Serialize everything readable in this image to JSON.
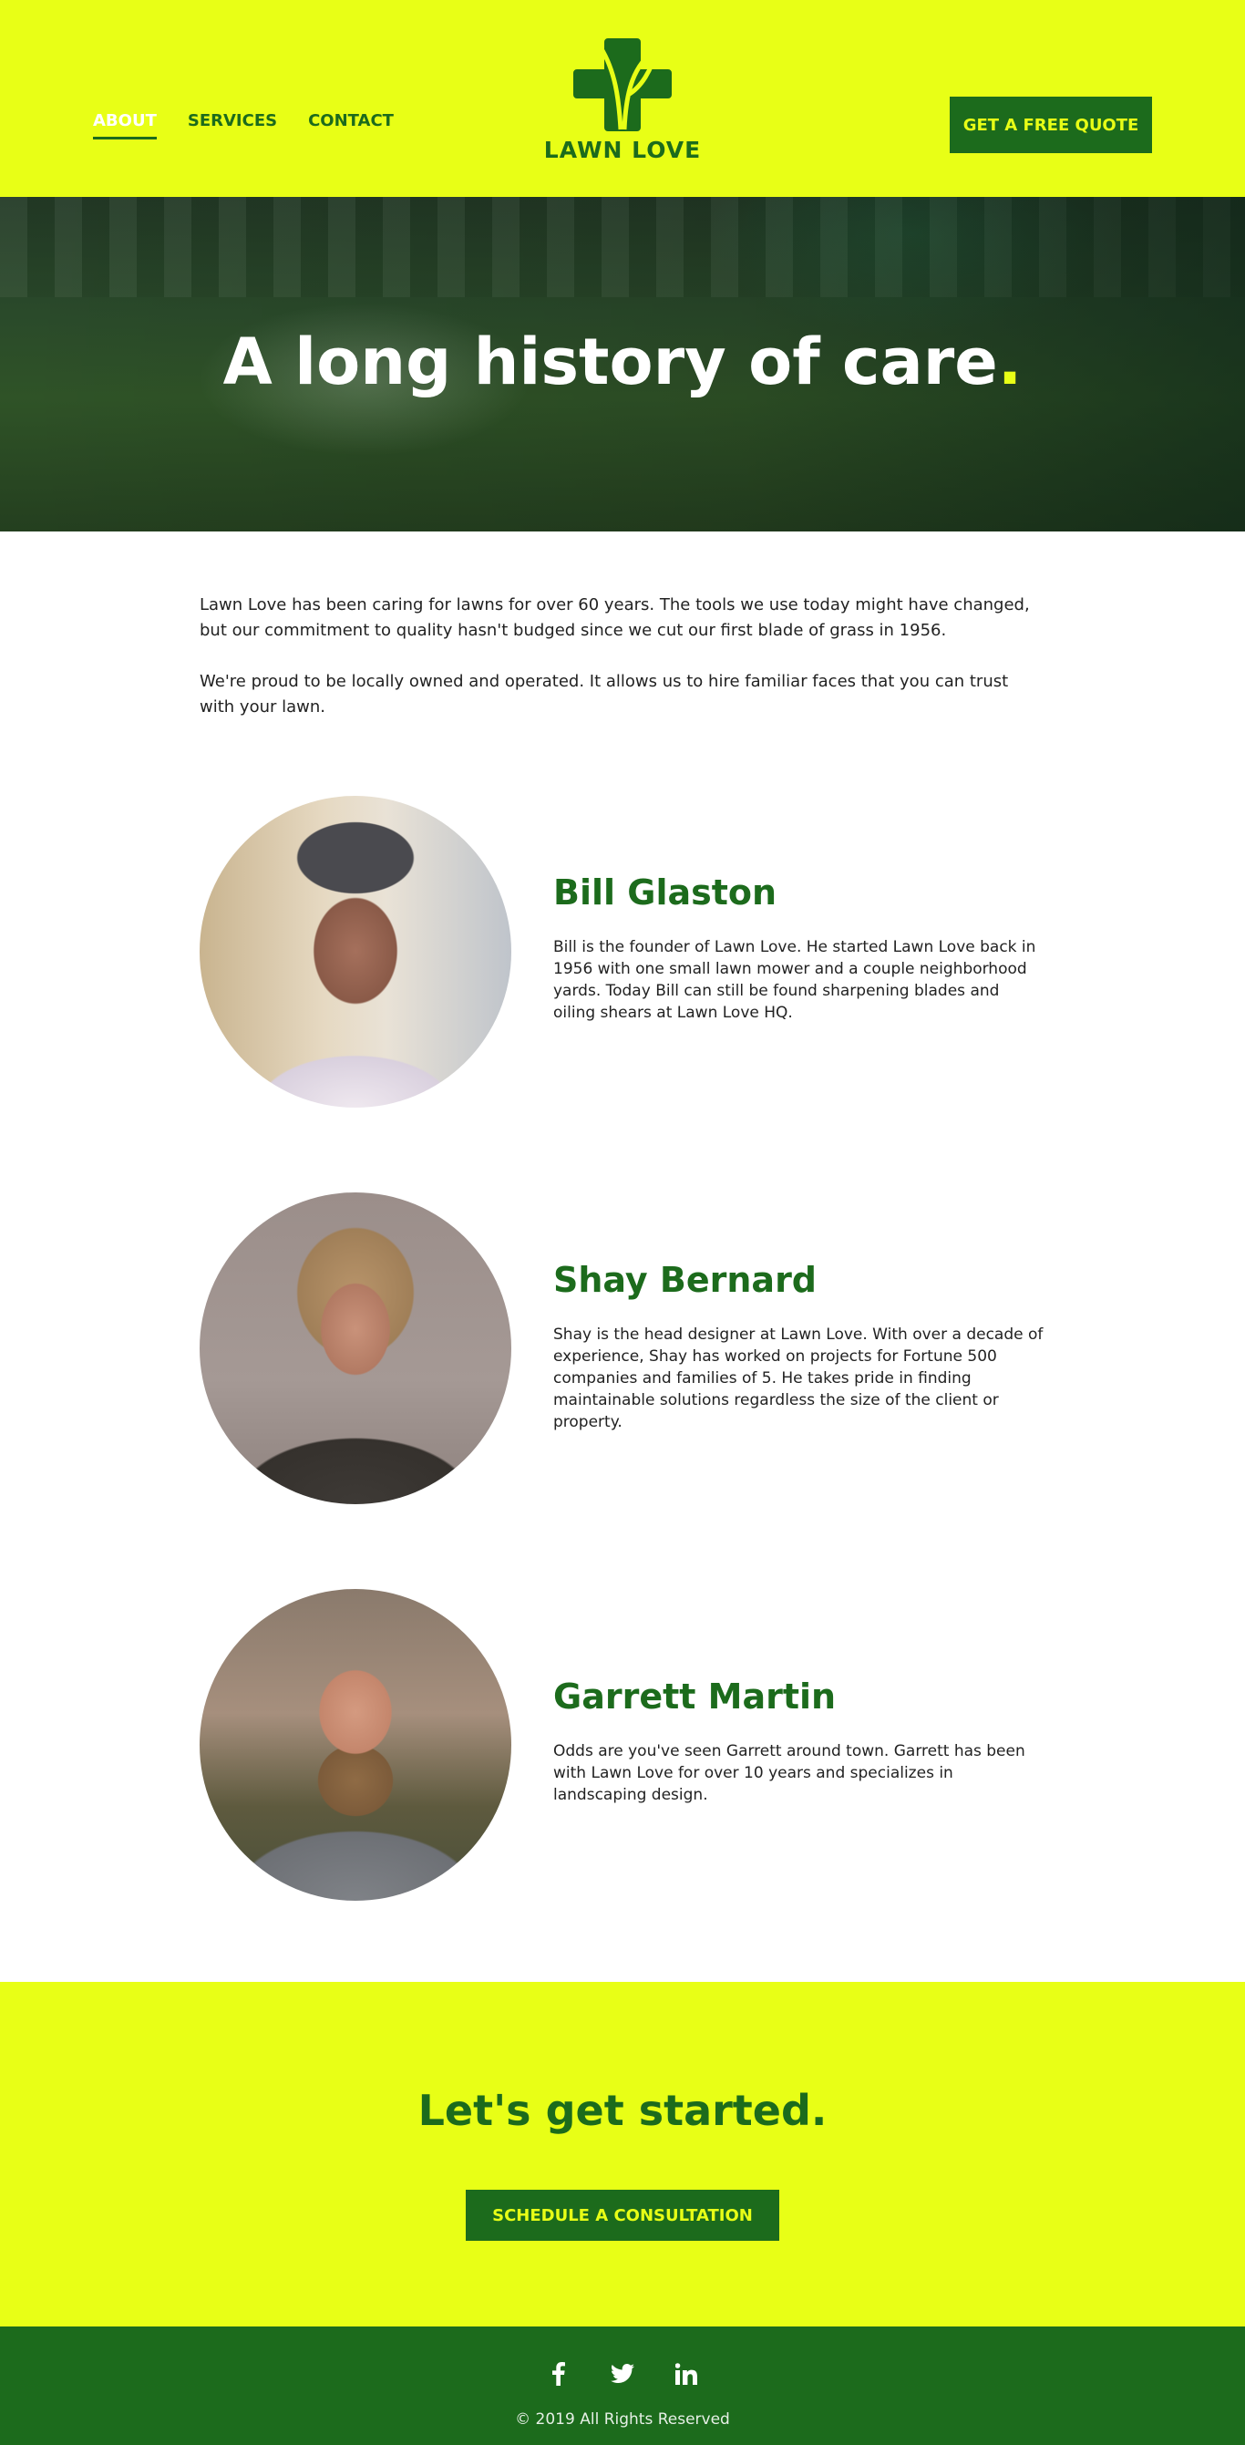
{
  "nav": {
    "items": [
      {
        "label": "ABOUT",
        "active": true
      },
      {
        "label": "SERVICES",
        "active": false
      },
      {
        "label": "CONTACT",
        "active": false
      }
    ]
  },
  "logo": {
    "text": "LAWN LOVE",
    "icon": "leaf-cross-icon"
  },
  "header": {
    "cta_label": "GET A FREE QUOTE"
  },
  "hero": {
    "title": "A long history of care",
    "title_dot": "."
  },
  "intro": {
    "paragraphs": [
      "Lawn Love has been caring for lawns for over 60 years. The tools we use today might have changed, but our commitment to quality hasn't budged since we cut our first blade of grass in 1956.",
      "We're proud to be locally owned and operated. It allows us to hire familiar faces that you can trust with your lawn."
    ]
  },
  "team": [
    {
      "name": "Bill Glaston",
      "bio": "Bill is the founder of Lawn Love. He started Lawn Love back in 1956 with one small lawn mower and a couple neighborhood yards. Today Bill can still be found sharpening blades and oiling shears at Lawn Love HQ."
    },
    {
      "name": "Shay Bernard",
      "bio": "Shay is the head designer at Lawn Love. With over a decade of experience, Shay has worked on projects for Fortune 500 companies and families of 5. He takes pride in finding maintainable solutions regardless the size of the client or property."
    },
    {
      "name": "Garrett Martin",
      "bio": "Odds are you've seen Garrett around town. Garrett has been with Lawn Love for over 10 years and specializes in landscaping design."
    }
  ],
  "cta": {
    "title": "Let's get started.",
    "button_label": "SCHEDULE A CONSULTATION"
  },
  "footer": {
    "socials": [
      "facebook-icon",
      "twitter-icon",
      "linkedin-icon"
    ],
    "copyright": "© 2019 All Rights Reserved"
  },
  "colors": {
    "brand_yellow": "#e8ff16",
    "brand_green": "#1c6b1c"
  }
}
